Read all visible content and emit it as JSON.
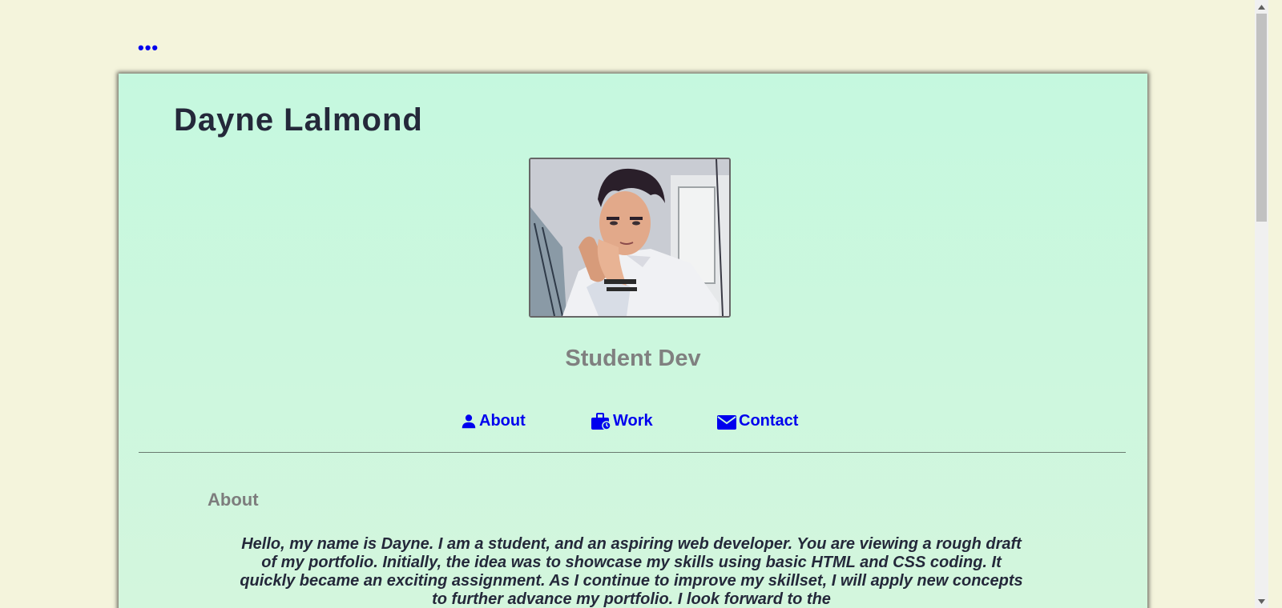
{
  "header": {
    "menu_label": "•••"
  },
  "profile": {
    "name": "Dayne Lalmond",
    "photo_icon": "profile-photo",
    "subtitle": "Student Dev"
  },
  "nav": {
    "items": [
      {
        "label": "About",
        "icon": "person-icon"
      },
      {
        "label": "Work",
        "icon": "briefcase-icon"
      },
      {
        "label": "Contact",
        "icon": "mail-icon"
      }
    ],
    "link_color": "#0000ee"
  },
  "about": {
    "heading": "About",
    "text": "Hello, my name is Dayne. I am a student, and an aspiring web developer. You are viewing a rough draft of my portfolio. Initially, the idea was to showcase my skills using basic HTML and CSS coding. It quickly became an exciting assignment. As I continue to improve my skillset, I will apply new concepts to further advance my portfolio. I look forward to the"
  },
  "colors": {
    "page_background": "#f4f4dc",
    "card_background": "#c5f8df",
    "title_text": "#24283a",
    "muted_text": "#808080"
  }
}
